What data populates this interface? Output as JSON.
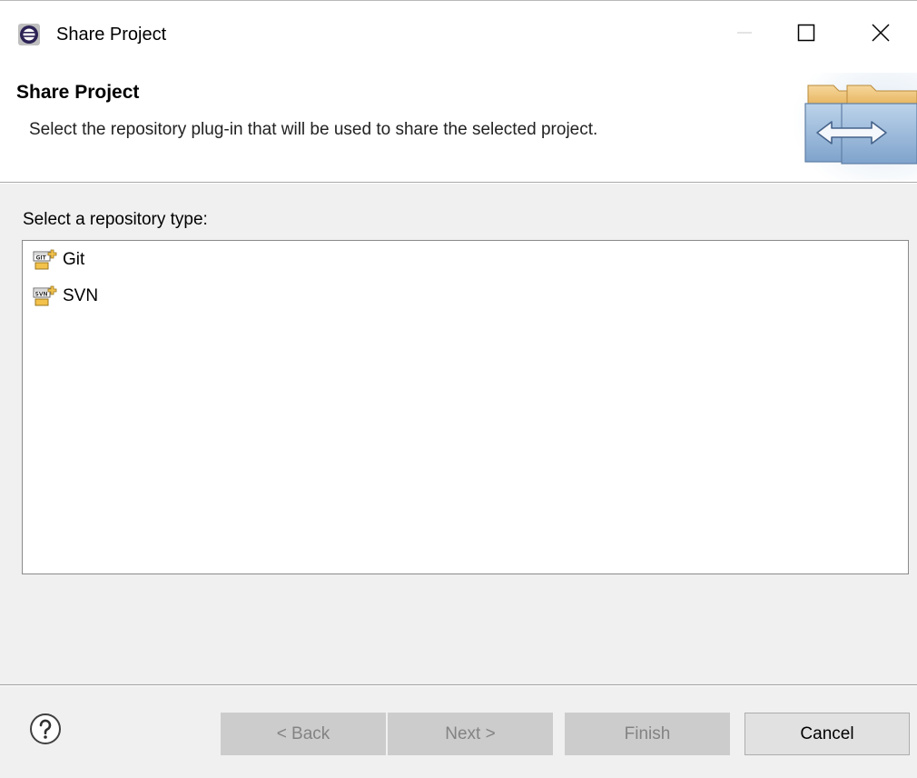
{
  "window": {
    "title": "Share Project",
    "app_icon": "eclipse-icon",
    "controls": {
      "minimize": "minimize-icon",
      "maximize": "maximize-icon",
      "close": "close-icon"
    }
  },
  "banner": {
    "title": "Share Project",
    "description": "Select the repository plug-in that will be used to share the selected project.",
    "image": "share-project-wizard-icon"
  },
  "main": {
    "label": "Select a repository type:",
    "repository_types": [
      {
        "label": "Git",
        "icon": "git-repository-icon"
      },
      {
        "label": "SVN",
        "icon": "svn-repository-icon"
      }
    ]
  },
  "footer": {
    "help_icon": "help-icon",
    "back_label": "< Back",
    "next_label": "Next >",
    "finish_label": "Finish",
    "cancel_label": "Cancel"
  },
  "colors": {
    "dialog_bg": "#f0f0f0",
    "disabled_button_bg": "#cccccc",
    "disabled_text": "#838383",
    "enabled_button_bg": "#e1e1e1"
  }
}
